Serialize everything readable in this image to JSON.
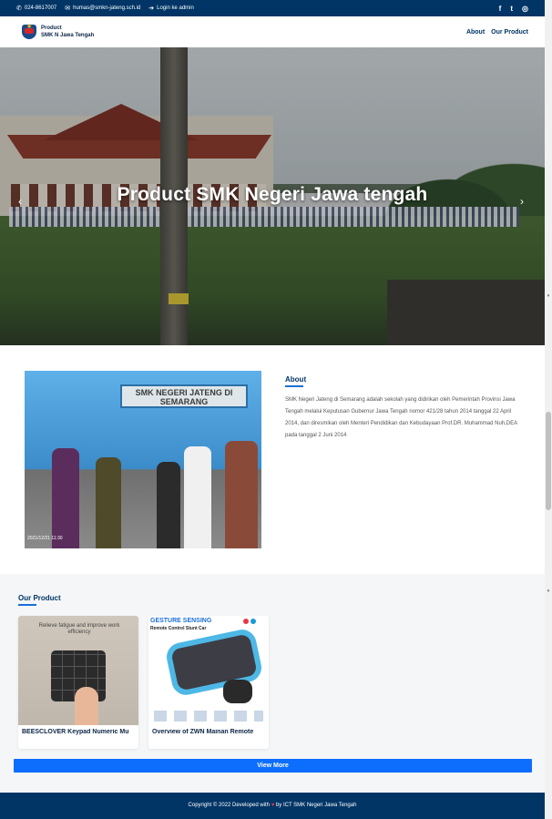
{
  "topbar": {
    "phone": "024-8617007",
    "email": "humas@smkn-jateng.sch.id",
    "login": "Login ke admin",
    "social": [
      "facebook",
      "twitter",
      "instagram"
    ]
  },
  "navbar": {
    "brand_line1": "Product",
    "brand_line2": "SMK N Jawa Tengah",
    "links": [
      "About",
      "Our Product"
    ]
  },
  "hero": {
    "title": "Product SMK Negeri Jawa tengah",
    "prev_icon": "‹",
    "next_icon": "›"
  },
  "about": {
    "image_sign": "SMK NEGERI JATENG DI SEMARANG",
    "image_timestamp": "2021/12/21 11:30",
    "title": "About",
    "description": "SMK Negeri Jateng di Semarang adalah sekolah yang didirikan oleh Pemerintah Provinsi Jawa Tengah melalui Keputusan Gubernur Jawa Tengah nomor 421/28 tahun 2014 tanggal 22 April 2014, dan diresmikan oleh Menteri Pendidikan dan Kebudayaan Prof.DR. Muhammad Nuh,DEA pada tanggal 2 Juni 2014"
  },
  "products": {
    "section_title": "Our Product",
    "items": [
      {
        "name": "BEESCLOVER Keypad Numeric Mu",
        "image_text": "Relieve fatigue and improve work efficiency"
      },
      {
        "name": "Overview of ZWN Mainan Remote",
        "image_title": "GESTURE SENSING",
        "image_subtitle": "Remote Control Stunt Car"
      }
    ],
    "view_more": "View More"
  },
  "footer": {
    "before": "Copyright © 2022 Developed with",
    "after": "by ICT SMK Negeri Jawa Tengah"
  },
  "colors": {
    "primary_navy": "#003566",
    "accent_blue": "#0d6efd",
    "heart": "#e63946"
  }
}
